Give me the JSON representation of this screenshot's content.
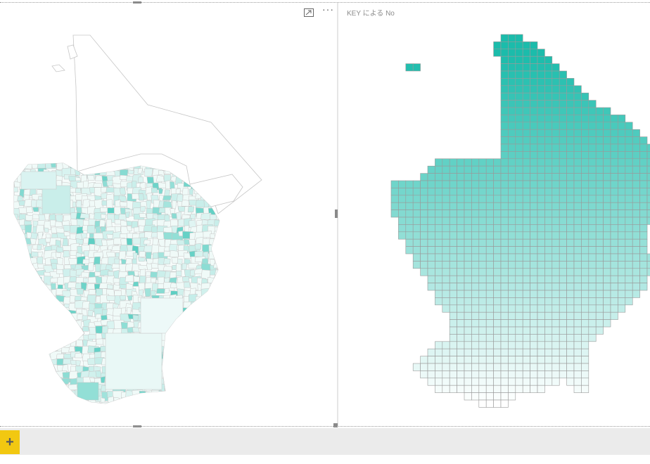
{
  "right_visual": {
    "title": "KEY による No",
    "fill_low": "#ffffff",
    "fill_high": "#1bbcab",
    "border_color": "#9a9a9a"
  },
  "left_visual": {
    "fill_low": "#f4fbfa",
    "fill_high": "#1bbcab",
    "border_color": "#c6c6c6"
  },
  "toolbar": {
    "focus_mode_icon": "focus-mode-icon",
    "more_options_icon": "more-options-icon",
    "more_options_label": "···"
  },
  "page_tabs": {
    "add_page_label": "+"
  }
}
